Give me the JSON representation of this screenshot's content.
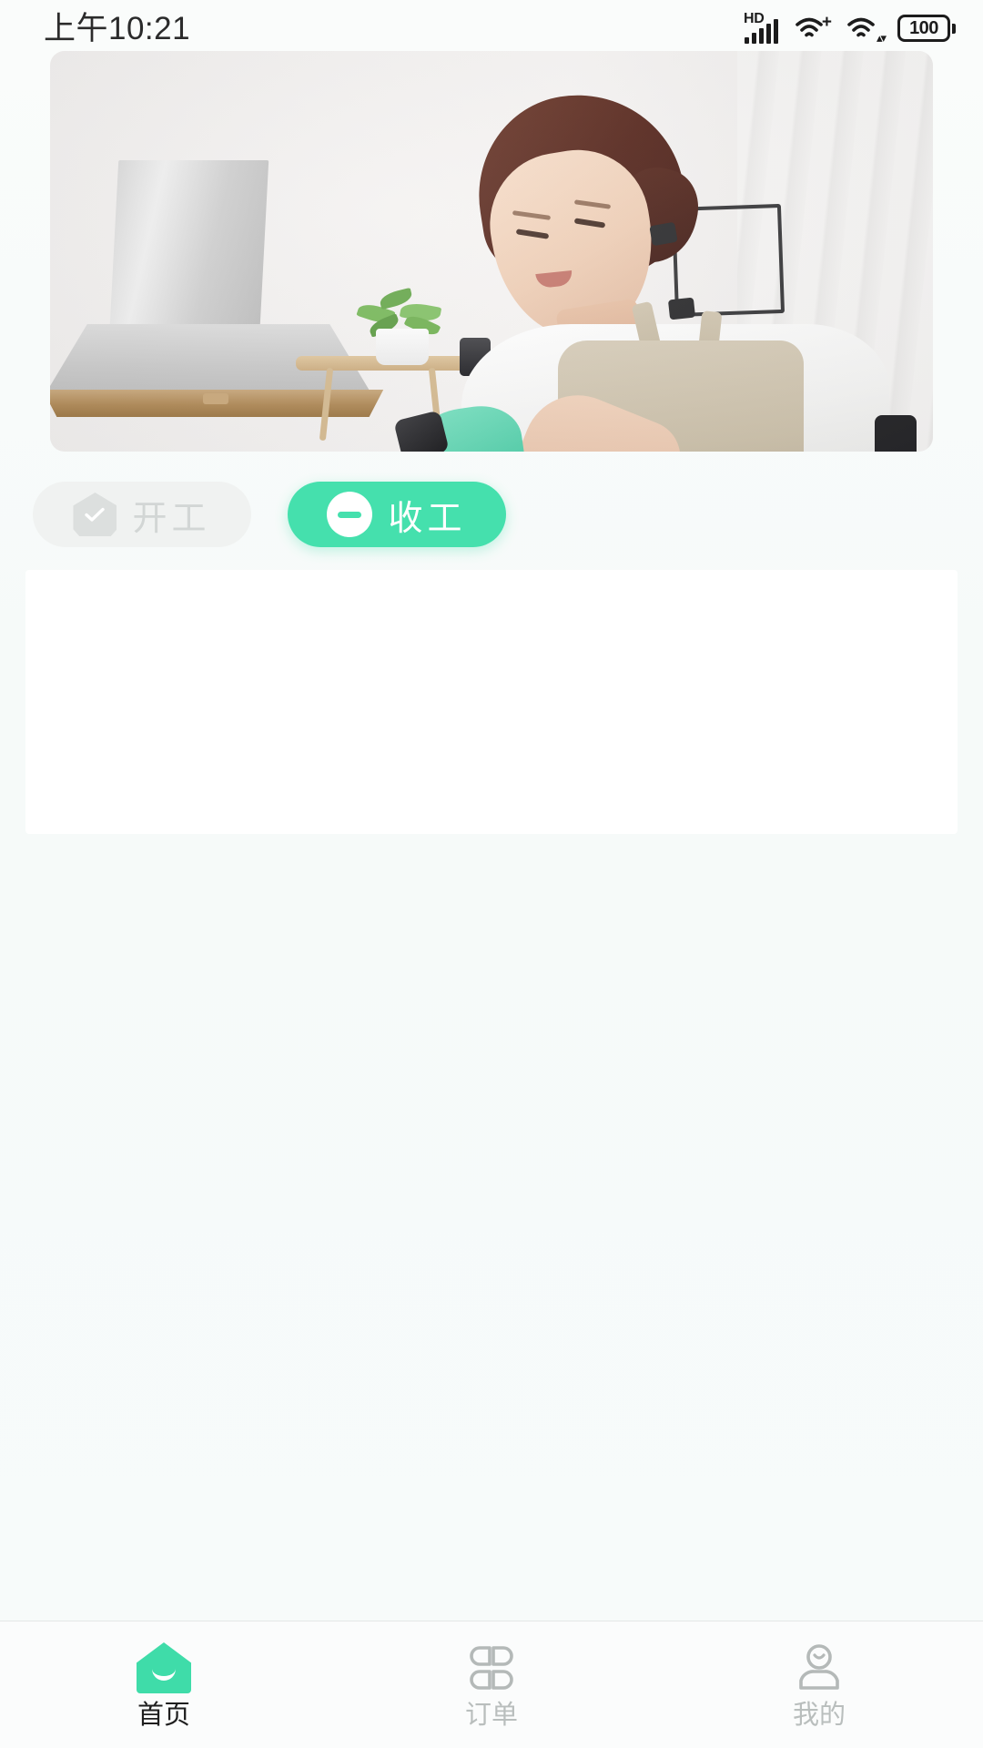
{
  "status_bar": {
    "time": "上午10:21",
    "network_label": "HD",
    "battery_level": "100",
    "icons": [
      "hd-signal-icon",
      "wifi-plus-icon",
      "wifi-data-icon",
      "battery-icon"
    ]
  },
  "banner": {
    "alt": "housekeeper cleaning kitchen banner",
    "icon": "banner-image"
  },
  "actions": {
    "start": {
      "label": "开工",
      "icon": "shield-check-icon",
      "state": "disabled"
    },
    "end": {
      "label": "收工",
      "icon": "minus-circle-icon",
      "state": "active"
    }
  },
  "content": {
    "card_text": ""
  },
  "tabbar": {
    "items": [
      {
        "label": "首页",
        "icon": "home-icon",
        "active": true
      },
      {
        "label": "订单",
        "icon": "clover-grid-icon",
        "active": false
      },
      {
        "label": "我的",
        "icon": "person-icon",
        "active": false
      }
    ]
  },
  "colors": {
    "accent": "#45e0ad",
    "accent_home": "#3fdca9",
    "disabled_bg": "#f0f2f1",
    "disabled_text": "#d2d6d5",
    "inactive_tab": "#b9bebd",
    "page_bg": "#f7faf9",
    "card_bg": "#ffffff"
  }
}
